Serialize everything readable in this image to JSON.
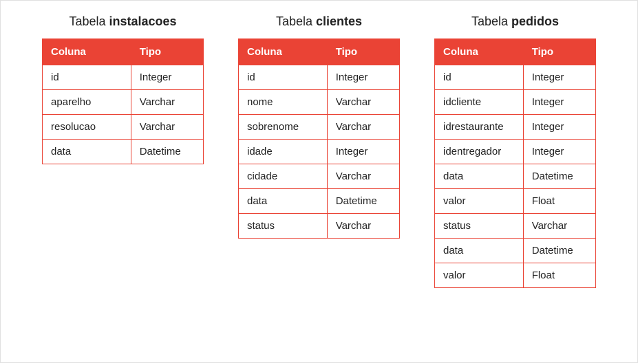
{
  "title_prefix": "Tabela ",
  "header_col1": "Coluna",
  "header_col2": "Tipo",
  "tables": [
    {
      "name": "instalacoes",
      "rows": [
        {
          "col": "id",
          "type": "Integer"
        },
        {
          "col": "aparelho",
          "type": "Varchar"
        },
        {
          "col": "resolucao",
          "type": "Varchar"
        },
        {
          "col": "data",
          "type": "Datetime"
        }
      ]
    },
    {
      "name": "clientes",
      "rows": [
        {
          "col": "id",
          "type": "Integer"
        },
        {
          "col": "nome",
          "type": "Varchar"
        },
        {
          "col": "sobrenome",
          "type": "Varchar"
        },
        {
          "col": "idade",
          "type": "Integer"
        },
        {
          "col": "cidade",
          "type": "Varchar"
        },
        {
          "col": "data",
          "type": "Datetime"
        },
        {
          "col": "status",
          "type": "Varchar"
        }
      ]
    },
    {
      "name": "pedidos",
      "rows": [
        {
          "col": "id",
          "type": "Integer"
        },
        {
          "col": "idcliente",
          "type": "Integer"
        },
        {
          "col": "idrestaurante",
          "type": "Integer"
        },
        {
          "col": "identregador",
          "type": "Integer"
        },
        {
          "col": "data",
          "type": "Datetime"
        },
        {
          "col": "valor",
          "type": "Float"
        },
        {
          "col": "status",
          "type": "Varchar"
        },
        {
          "col": "data",
          "type": "Datetime"
        },
        {
          "col": "valor",
          "type": "Float"
        }
      ]
    }
  ]
}
